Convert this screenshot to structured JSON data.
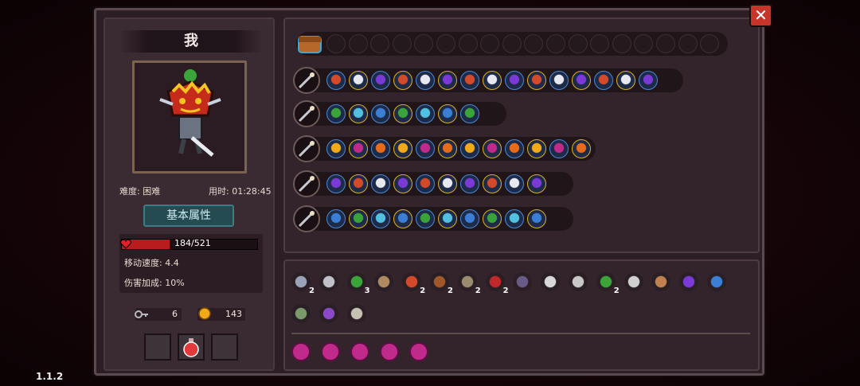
{
  "player": {
    "name": "我",
    "difficulty": "难度: 困难",
    "time": "用时: 01:28:45"
  },
  "attributes_tab": "基本属性",
  "hp": {
    "current": 184,
    "max": 521,
    "label": "184/521"
  },
  "stats": {
    "move_speed": "移动速度: 4.4",
    "damage_bonus": "伤害加成: 10%"
  },
  "resources": {
    "keys": "6",
    "gold": "143"
  },
  "version": "1.1.2",
  "close_label": "✕",
  "colors": {
    "hp_fill": "#b81c1c",
    "frame": "#2c1e25",
    "perk": "#c02a8a",
    "close": "#c7352a",
    "accent_tab": "#244a52"
  },
  "inventory": {
    "icons": [
      "chest-icon"
    ],
    "items_row1_counts": [
      "2",
      "",
      "3",
      "",
      "2",
      "2",
      "2",
      "2",
      "",
      "",
      "",
      "2",
      "",
      "",
      "",
      ""
    ],
    "perk_count": 5
  },
  "wands": [
    {
      "name": "wand-1",
      "slots": 15
    },
    {
      "name": "wand-2",
      "slots": 7
    },
    {
      "name": "wand-3",
      "slots": 12
    },
    {
      "name": "wand-4",
      "slots": 10
    },
    {
      "name": "wand-5",
      "slots": 10
    }
  ]
}
